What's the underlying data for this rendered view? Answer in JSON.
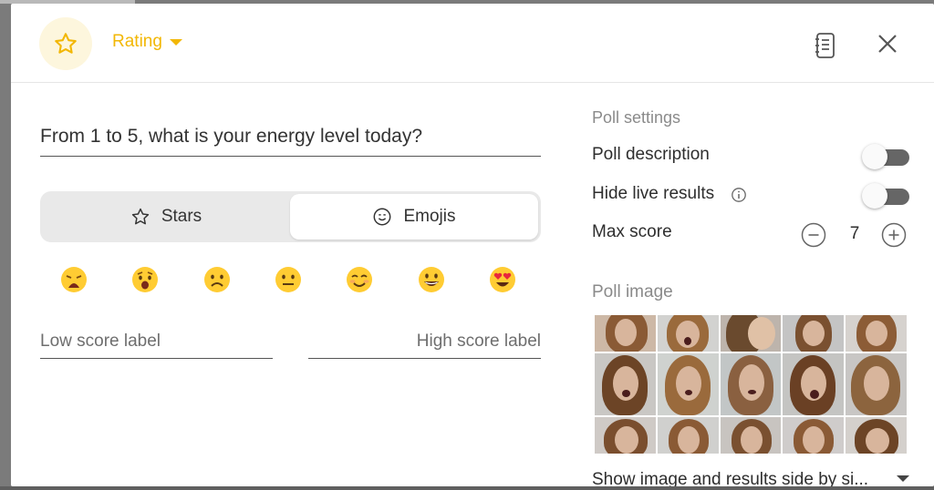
{
  "header": {
    "type_label": "Rating",
    "type_icon": "star-icon",
    "accent_color": "#f2b705",
    "notes_icon": "notes-icon",
    "close_icon": "close-icon"
  },
  "question": {
    "text": "From 1 to 5, what is your energy level today?"
  },
  "rating_style": {
    "options": [
      {
        "label": "Stars",
        "icon": "star-icon",
        "selected": false
      },
      {
        "label": "Emojis",
        "icon": "smiley-icon",
        "selected": true
      }
    ]
  },
  "emojis": [
    "😩",
    "😧",
    "☹️",
    "😐",
    "😊",
    "😀",
    "😍"
  ],
  "score_labels": {
    "low_placeholder": "Low score label",
    "high_placeholder": "High score label"
  },
  "settings": {
    "title": "Poll settings",
    "poll_description": {
      "label": "Poll description",
      "enabled": false
    },
    "hide_live_results": {
      "label": "Hide live results",
      "enabled": false
    },
    "max_score": {
      "label": "Max score",
      "value": "7"
    }
  },
  "poll_image": {
    "title": "Poll image",
    "layout_option": "Show image and results side by si..."
  }
}
